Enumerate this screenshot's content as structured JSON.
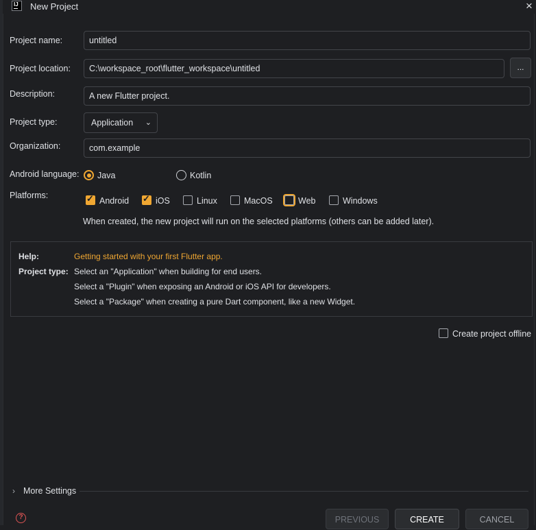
{
  "window": {
    "title": "New Project",
    "close_icon": "×"
  },
  "form": {
    "project_name": {
      "label": "Project name:",
      "value": "untitled"
    },
    "project_location": {
      "label": "Project location:",
      "value": "C:\\workspace_root\\flutter_workspace\\untitled",
      "browse_label": "..."
    },
    "description": {
      "label": "Description:",
      "value": "A new Flutter project."
    },
    "project_type": {
      "label": "Project type:",
      "selected": "Application"
    },
    "organization": {
      "label": "Organization:",
      "value": "com.example"
    },
    "android_language": {
      "label": "Android language:",
      "options": [
        "Java",
        "Kotlin"
      ],
      "selected": "Java"
    },
    "platforms": {
      "label": "Platforms:",
      "items": [
        {
          "label": "Android",
          "checked": true
        },
        {
          "label": "iOS",
          "checked": true
        },
        {
          "label": "Linux",
          "checked": false
        },
        {
          "label": "MacOS",
          "checked": false
        },
        {
          "label": "Web",
          "checked": false,
          "focused": true
        },
        {
          "label": "Windows",
          "checked": false
        }
      ],
      "hint": "When created, the new project will run on the selected platforms (others can be added later)."
    }
  },
  "help": {
    "help_label": "Help:",
    "help_link": "Getting started with your first Flutter app.",
    "type_label": "Project type:",
    "lines": [
      "Select an \"Application\" when building for end users.",
      "Select a \"Plugin\" when exposing an Android or iOS API for developers.",
      "Select a \"Package\" when creating a pure Dart component, like a new Widget."
    ]
  },
  "offline": {
    "label": "Create project offline",
    "checked": false
  },
  "more_settings": {
    "label": "More Settings",
    "icon": "chevron-right-icon"
  },
  "footer": {
    "help_icon": "?",
    "previous_label": "PREVIOUS",
    "create_label": "CREATE",
    "cancel_label": "CANCEL"
  },
  "colors": {
    "accent": "#f0a732",
    "background": "#1e1f22",
    "border": "#43454a"
  }
}
